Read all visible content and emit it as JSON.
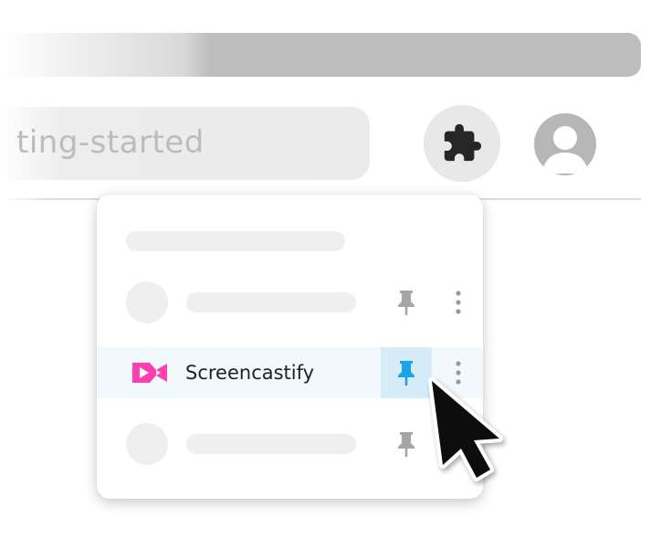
{
  "browser": {
    "address_bar": {
      "visible_text": "ting-started"
    }
  },
  "toolbar": {
    "extensions_icon": "puzzle-icon",
    "profile_icon": "user-avatar-icon"
  },
  "extensions_menu": {
    "items": [
      {
        "name": "",
        "pinned": false,
        "placeholder": true
      },
      {
        "name": "Screencastify",
        "pinned": true,
        "placeholder": false,
        "highlighted": true,
        "icon": "screencastify-logo"
      },
      {
        "name": "",
        "pinned": false,
        "placeholder": true
      }
    ],
    "colors": {
      "pin_active": "#1aa3e8",
      "pin_inactive": "#a6a6a6",
      "logo": "#ff3fae",
      "row_highlight": "#f1f9fd"
    }
  }
}
